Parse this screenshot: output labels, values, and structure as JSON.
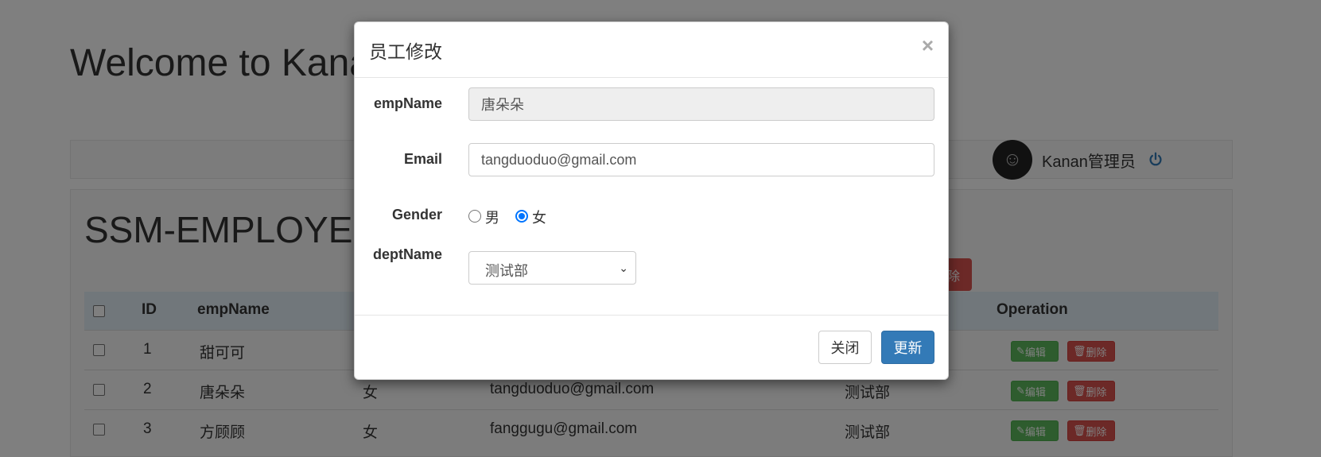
{
  "page": {
    "title": "Welcome to Kanan",
    "user": {
      "name": "Kanan管理员",
      "avatar_icon": "avatar-icon",
      "logout_icon": "power-icon"
    },
    "heading": "SSM-EMPLOYEE",
    "delete_all_label": "删除",
    "table": {
      "headers": {
        "id": "ID",
        "empName": "empName",
        "operation": "Operation"
      },
      "rows": [
        {
          "id": "1",
          "empName": "甜可可",
          "gender": "",
          "email": "",
          "dept": ""
        },
        {
          "id": "2",
          "empName": "唐朵朵",
          "gender": "女",
          "email": "tangduoduo@gmail.com",
          "dept": "测试部"
        },
        {
          "id": "3",
          "empName": "方顾顾",
          "gender": "女",
          "email": "fanggugu@gmail.com",
          "dept": "测试部"
        }
      ],
      "edit_label": "编辑",
      "delete_label": "删除"
    }
  },
  "modal": {
    "title": "员工修改",
    "close_symbol": "×",
    "fields": {
      "empName_label": "empName",
      "empName_value": "唐朵朵",
      "email_label": "Email",
      "email_value": "tangduoduo@gmail.com",
      "gender_label": "Gender",
      "gender_male": "男",
      "gender_female": "女",
      "gender_selected": "女",
      "dept_label": "deptName",
      "dept_value": "测试部"
    },
    "buttons": {
      "close": "关闭",
      "update": "更新"
    }
  },
  "colors": {
    "primary": "#337ab7",
    "danger": "#d9534f",
    "success": "#5cb85c"
  }
}
